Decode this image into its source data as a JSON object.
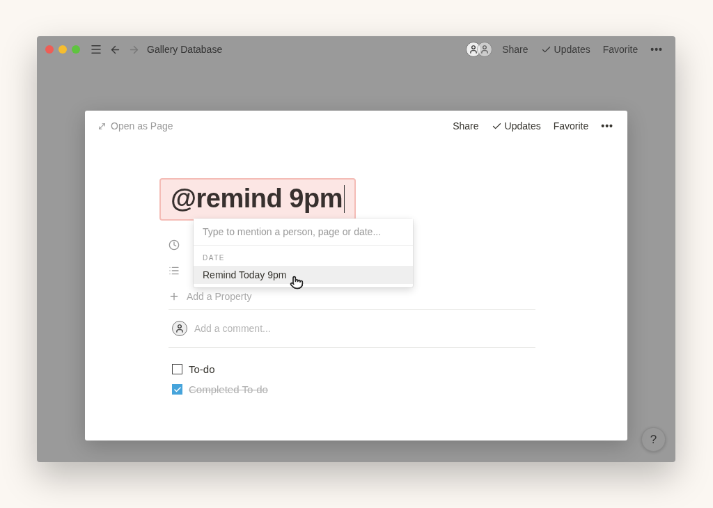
{
  "window": {
    "title": "Gallery Database",
    "actions": [
      "Share",
      "Updates",
      "Favorite",
      "•••"
    ]
  },
  "modal": {
    "open_as_page": "Open as Page",
    "actions": [
      "Share",
      "Updates",
      "Favorite",
      "•••"
    ],
    "title": "@remind 9pm",
    "properties": [
      {
        "kind": "clock"
      },
      {
        "kind": "list"
      },
      {
        "kind": "add",
        "label": "Add a Property"
      }
    ],
    "comment": {
      "placeholder": "Add a comment..."
    },
    "todos": [
      {
        "label": "To-do",
        "checked": false
      },
      {
        "label": "Completed To-do",
        "checked": true
      }
    ]
  },
  "mention_menu": {
    "placeholder": "Type to mention a person, page or date...",
    "section": "DATE",
    "items": [
      {
        "label": "Remind Today 9pm",
        "selected": true
      }
    ]
  },
  "help": "?"
}
